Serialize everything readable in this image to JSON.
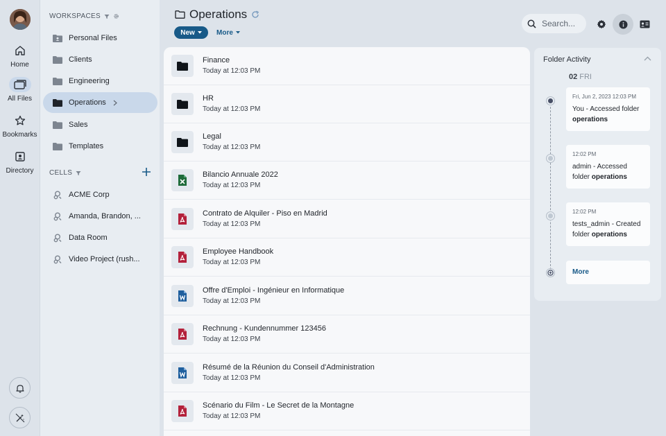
{
  "rail": {
    "items": [
      {
        "label": "Home",
        "icon": "home-icon"
      },
      {
        "label": "All Files",
        "icon": "files-icon"
      },
      {
        "label": "Bookmarks",
        "icon": "star-icon"
      },
      {
        "label": "Directory",
        "icon": "contact-icon"
      }
    ],
    "active": "All Files"
  },
  "sidebar": {
    "workspaces_heading": "WORKSPACES",
    "workspaces": [
      {
        "label": "Personal Files"
      },
      {
        "label": "Clients"
      },
      {
        "label": "Engineering"
      },
      {
        "label": "Operations",
        "active": true
      },
      {
        "label": "Sales"
      },
      {
        "label": "Templates"
      }
    ],
    "cells_heading": "CELLS",
    "cells": [
      {
        "label": "ACME Corp"
      },
      {
        "label": "Amanda, Brandon, ..."
      },
      {
        "label": "Data Room"
      },
      {
        "label": "Video Project (rush..."
      }
    ]
  },
  "header": {
    "title": "Operations",
    "new_label": "New",
    "more_label": "More",
    "search_placeholder": "Search..."
  },
  "files": [
    {
      "name": "Finance",
      "modified": "Today at 12:03 PM",
      "type": "folder"
    },
    {
      "name": "HR",
      "modified": "Today at 12:03 PM",
      "type": "folder"
    },
    {
      "name": "Legal",
      "modified": "Today at 12:03 PM",
      "type": "folder"
    },
    {
      "name": "Bilancio Annuale 2022",
      "modified": "Today at 12:03 PM",
      "type": "spreadsheet"
    },
    {
      "name": "Contrato de Alquiler - Piso en Madrid",
      "modified": "Today at 12:03 PM",
      "type": "pdf"
    },
    {
      "name": "Employee Handbook",
      "modified": "Today at 12:03 PM",
      "type": "pdf"
    },
    {
      "name": "Offre d'Emploi - Ingénieur en Informatique",
      "modified": "Today at 12:03 PM",
      "type": "word"
    },
    {
      "name": "Rechnung - Kundennummer 123456",
      "modified": "Today at 12:03 PM",
      "type": "pdf"
    },
    {
      "name": "Résumé de la Réunion du Conseil d'Administration",
      "modified": "Today at 12:03 PM",
      "type": "word"
    },
    {
      "name": "Scénario du Film - Le Secret de la Montagne",
      "modified": "Today at 12:03 PM",
      "type": "pdf"
    }
  ],
  "activity": {
    "title": "Folder Activity",
    "day_num": "02",
    "day_name": "FRI",
    "events": [
      {
        "time": "Fri, Jun 2, 2023 12:03 PM",
        "text": "You - Accessed folder",
        "target": "operations"
      },
      {
        "time": "12:02 PM",
        "text": "admin - Accessed folder",
        "target": "operations"
      },
      {
        "time": "12:02 PM",
        "text": "tests_admin - Created folder",
        "target": "operations"
      }
    ],
    "more_label": "More"
  },
  "colors": {
    "accent": "#185a88",
    "pdf": "#b3213b",
    "word": "#1f5f9e",
    "sheet": "#1e6b3a"
  }
}
